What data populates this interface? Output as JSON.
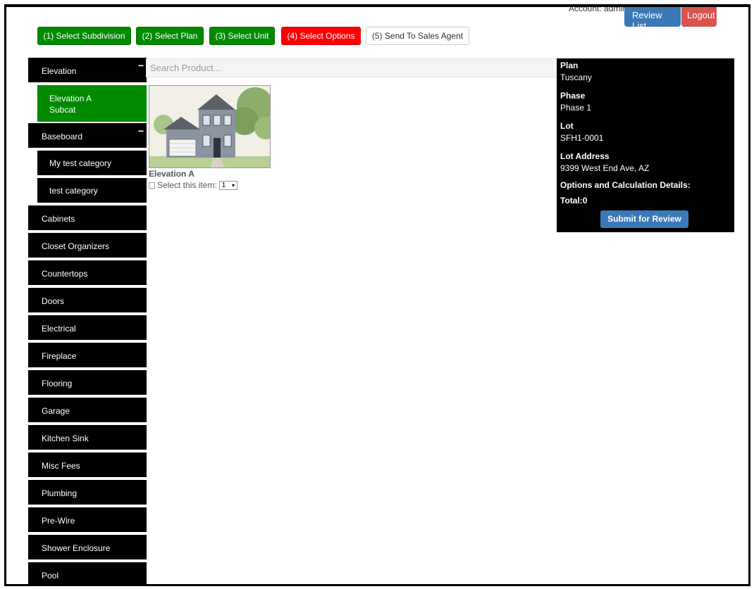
{
  "header": {
    "account": "Account: admin",
    "review_list": "Review List",
    "logout": "Logout"
  },
  "steps": [
    {
      "label": "(1) Select Subdivision",
      "state": "done"
    },
    {
      "label": "(2) Select Plan",
      "state": "done"
    },
    {
      "label": "(3) Select Unit",
      "state": "done"
    },
    {
      "label": "(4) Select Options",
      "state": "current"
    },
    {
      "label": "(5) Send To Sales Agent",
      "state": "pending"
    }
  ],
  "colors": {
    "step_done": "#008a00",
    "step_current": "#ff0000",
    "primary": "#3b78b6",
    "danger": "#d9534f"
  },
  "sidebar": {
    "collapse_symbol": "−",
    "elevation": {
      "label": "Elevation",
      "sub": [
        "Elevation A Subcat"
      ]
    },
    "baseboard": {
      "label": "Baseboard",
      "sub": [
        "My test category",
        "test category"
      ]
    },
    "categories": [
      "Cabinets",
      "Closet Organizers",
      "Countertops",
      "Doors",
      "Electrical",
      "Fireplace",
      "Flooring",
      "Garage",
      "Kitchen Sink",
      "Misc Fees",
      "Plumbing",
      "Pre-Wire",
      "Shower Enclosure",
      "Pool"
    ]
  },
  "search": {
    "placeholder": "Search Product..."
  },
  "product": {
    "name": "Elevation A",
    "select_label": "Select this item:",
    "quantity": "1",
    "dropdown_symbol": "▾",
    "image": "house-elevation-illustration"
  },
  "info": {
    "plan_label": "Plan",
    "plan": "Tuscany",
    "phase_label": "Phase",
    "phase": "Phase 1",
    "lot_label": "Lot",
    "lot": "SFH1-0001",
    "address_label": "Lot Address",
    "address": "9399 West End Ave, AZ",
    "options_label": "Options and Calculation Details:",
    "total": "Total:0",
    "submit": "Submit for Review"
  }
}
